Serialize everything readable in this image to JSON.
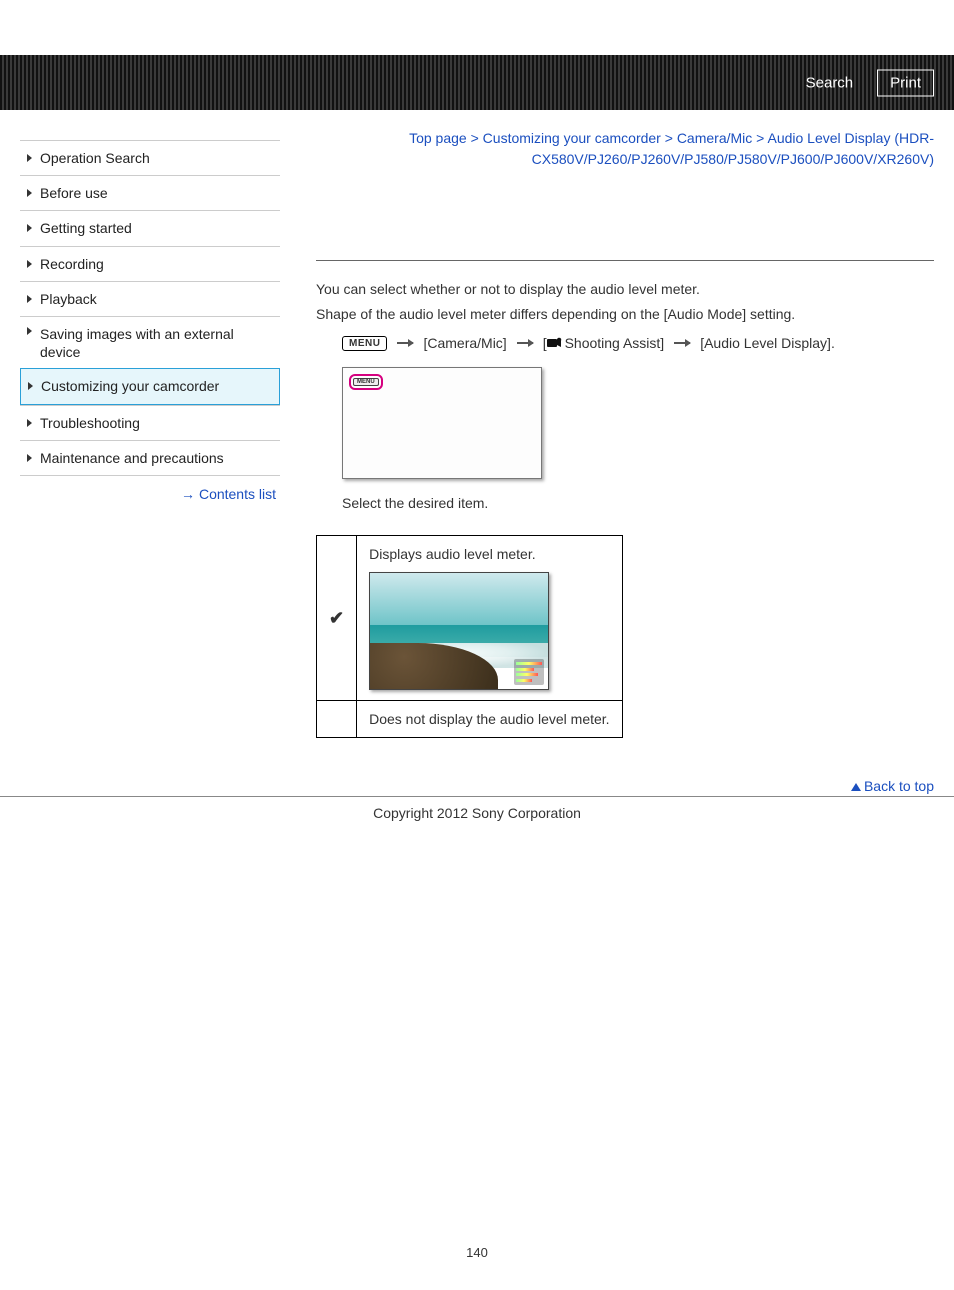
{
  "header": {
    "search_label": "Search",
    "print_label": "Print"
  },
  "sidebar": {
    "items": [
      {
        "label": "Operation Search",
        "active": false
      },
      {
        "label": "Before use",
        "active": false
      },
      {
        "label": "Getting started",
        "active": false
      },
      {
        "label": "Recording",
        "active": false
      },
      {
        "label": "Playback",
        "active": false
      },
      {
        "label": "Saving images with an external device",
        "active": false
      },
      {
        "label": "Customizing your camcorder",
        "active": true
      },
      {
        "label": "Troubleshooting",
        "active": false
      },
      {
        "label": "Maintenance and precautions",
        "active": false
      }
    ],
    "contents_list_label": "Contents list"
  },
  "breadcrumb": {
    "top": "Top page",
    "sep": ">",
    "l1": "Customizing your camcorder",
    "l2": "Camera/Mic",
    "l3": "Audio Level Display (HDR-CX580V/PJ260/PJ260V/PJ580/PJ580V/PJ600/PJ600V/XR260V)"
  },
  "content": {
    "line1": "You can select whether or not to display the audio level meter.",
    "line2": "Shape of the audio level meter differs depending on the [Audio Mode] setting.",
    "menu_label": "MENU",
    "path_step1": "[Camera/Mic]",
    "path_step2_prefix": "[",
    "path_step2_text": "Shooting Assist]",
    "path_step3": "[Audio Level Display].",
    "select_text": "Select the desired item.",
    "options": [
      {
        "checked": true,
        "desc": "Displays audio level meter."
      },
      {
        "checked": false,
        "desc": "Does not display the audio level meter."
      }
    ]
  },
  "footer": {
    "back_to_top": "Back to top",
    "copyright": "Copyright 2012 Sony Corporation",
    "page_number": "140"
  }
}
